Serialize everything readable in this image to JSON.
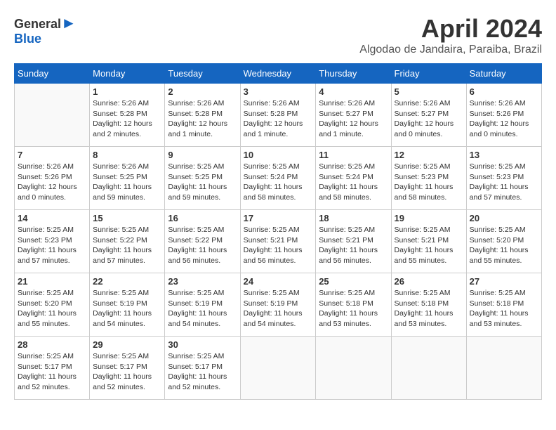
{
  "header": {
    "logo_line1": "General",
    "logo_line2": "Blue",
    "month": "April 2024",
    "location": "Algodao de Jandaira, Paraiba, Brazil"
  },
  "weekdays": [
    "Sunday",
    "Monday",
    "Tuesday",
    "Wednesday",
    "Thursday",
    "Friday",
    "Saturday"
  ],
  "weeks": [
    [
      {
        "day": "",
        "info": ""
      },
      {
        "day": "1",
        "info": "Sunrise: 5:26 AM\nSunset: 5:28 PM\nDaylight: 12 hours\nand 2 minutes."
      },
      {
        "day": "2",
        "info": "Sunrise: 5:26 AM\nSunset: 5:28 PM\nDaylight: 12 hours\nand 1 minute."
      },
      {
        "day": "3",
        "info": "Sunrise: 5:26 AM\nSunset: 5:28 PM\nDaylight: 12 hours\nand 1 minute."
      },
      {
        "day": "4",
        "info": "Sunrise: 5:26 AM\nSunset: 5:27 PM\nDaylight: 12 hours\nand 1 minute."
      },
      {
        "day": "5",
        "info": "Sunrise: 5:26 AM\nSunset: 5:27 PM\nDaylight: 12 hours\nand 0 minutes."
      },
      {
        "day": "6",
        "info": "Sunrise: 5:26 AM\nSunset: 5:26 PM\nDaylight: 12 hours\nand 0 minutes."
      }
    ],
    [
      {
        "day": "7",
        "info": "Sunrise: 5:26 AM\nSunset: 5:26 PM\nDaylight: 12 hours\nand 0 minutes."
      },
      {
        "day": "8",
        "info": "Sunrise: 5:26 AM\nSunset: 5:25 PM\nDaylight: 11 hours\nand 59 minutes."
      },
      {
        "day": "9",
        "info": "Sunrise: 5:25 AM\nSunset: 5:25 PM\nDaylight: 11 hours\nand 59 minutes."
      },
      {
        "day": "10",
        "info": "Sunrise: 5:25 AM\nSunset: 5:24 PM\nDaylight: 11 hours\nand 58 minutes."
      },
      {
        "day": "11",
        "info": "Sunrise: 5:25 AM\nSunset: 5:24 PM\nDaylight: 11 hours\nand 58 minutes."
      },
      {
        "day": "12",
        "info": "Sunrise: 5:25 AM\nSunset: 5:23 PM\nDaylight: 11 hours\nand 58 minutes."
      },
      {
        "day": "13",
        "info": "Sunrise: 5:25 AM\nSunset: 5:23 PM\nDaylight: 11 hours\nand 57 minutes."
      }
    ],
    [
      {
        "day": "14",
        "info": "Sunrise: 5:25 AM\nSunset: 5:23 PM\nDaylight: 11 hours\nand 57 minutes."
      },
      {
        "day": "15",
        "info": "Sunrise: 5:25 AM\nSunset: 5:22 PM\nDaylight: 11 hours\nand 57 minutes."
      },
      {
        "day": "16",
        "info": "Sunrise: 5:25 AM\nSunset: 5:22 PM\nDaylight: 11 hours\nand 56 minutes."
      },
      {
        "day": "17",
        "info": "Sunrise: 5:25 AM\nSunset: 5:21 PM\nDaylight: 11 hours\nand 56 minutes."
      },
      {
        "day": "18",
        "info": "Sunrise: 5:25 AM\nSunset: 5:21 PM\nDaylight: 11 hours\nand 56 minutes."
      },
      {
        "day": "19",
        "info": "Sunrise: 5:25 AM\nSunset: 5:21 PM\nDaylight: 11 hours\nand 55 minutes."
      },
      {
        "day": "20",
        "info": "Sunrise: 5:25 AM\nSunset: 5:20 PM\nDaylight: 11 hours\nand 55 minutes."
      }
    ],
    [
      {
        "day": "21",
        "info": "Sunrise: 5:25 AM\nSunset: 5:20 PM\nDaylight: 11 hours\nand 55 minutes."
      },
      {
        "day": "22",
        "info": "Sunrise: 5:25 AM\nSunset: 5:19 PM\nDaylight: 11 hours\nand 54 minutes."
      },
      {
        "day": "23",
        "info": "Sunrise: 5:25 AM\nSunset: 5:19 PM\nDaylight: 11 hours\nand 54 minutes."
      },
      {
        "day": "24",
        "info": "Sunrise: 5:25 AM\nSunset: 5:19 PM\nDaylight: 11 hours\nand 54 minutes."
      },
      {
        "day": "25",
        "info": "Sunrise: 5:25 AM\nSunset: 5:18 PM\nDaylight: 11 hours\nand 53 minutes."
      },
      {
        "day": "26",
        "info": "Sunrise: 5:25 AM\nSunset: 5:18 PM\nDaylight: 11 hours\nand 53 minutes."
      },
      {
        "day": "27",
        "info": "Sunrise: 5:25 AM\nSunset: 5:18 PM\nDaylight: 11 hours\nand 53 minutes."
      }
    ],
    [
      {
        "day": "28",
        "info": "Sunrise: 5:25 AM\nSunset: 5:17 PM\nDaylight: 11 hours\nand 52 minutes."
      },
      {
        "day": "29",
        "info": "Sunrise: 5:25 AM\nSunset: 5:17 PM\nDaylight: 11 hours\nand 52 minutes."
      },
      {
        "day": "30",
        "info": "Sunrise: 5:25 AM\nSunset: 5:17 PM\nDaylight: 11 hours\nand 52 minutes."
      },
      {
        "day": "",
        "info": ""
      },
      {
        "day": "",
        "info": ""
      },
      {
        "day": "",
        "info": ""
      },
      {
        "day": "",
        "info": ""
      }
    ]
  ]
}
